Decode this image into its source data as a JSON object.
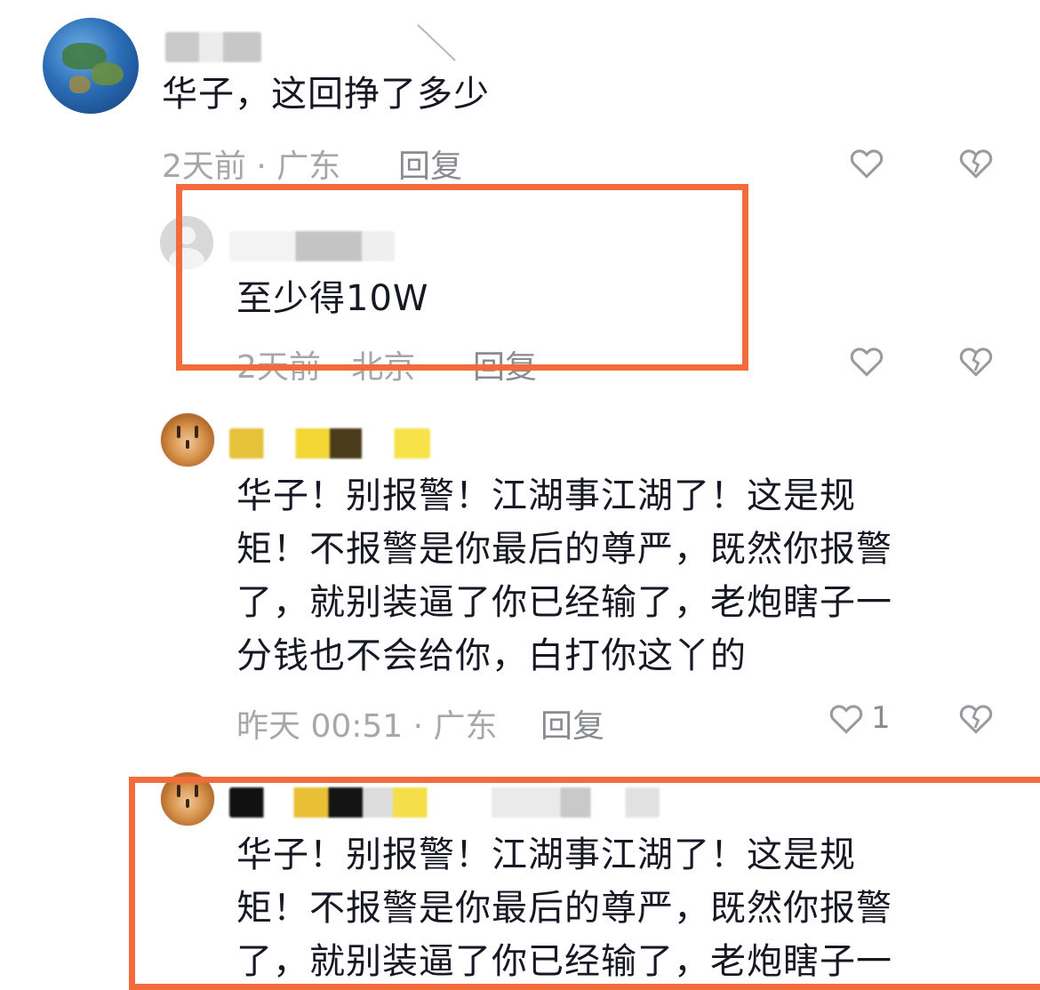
{
  "accent_color": "#f26b3d",
  "comments": [
    {
      "text": "华子，这回挣了多少",
      "meta": "2天前 · 广东",
      "reply_label": "回复",
      "like_icon": "heart-outline-icon",
      "dislike_icon": "broken-heart-icon"
    },
    {
      "text": "至少得10W",
      "meta": "2天前 · 北京",
      "reply_label": "回复",
      "like_icon": "heart-outline-icon",
      "dislike_icon": "broken-heart-icon"
    },
    {
      "lines": [
        "华子！别报警！江湖事江湖了！这是规",
        "矩！不报警是你最后的尊严，既然你报警",
        "了，就别装逼了你已经输了，老炮瞎子一",
        "分钱也不会给你，白打你这丫的"
      ],
      "meta": "昨天 00:51 · 广东",
      "reply_label": "回复",
      "like_count": "1",
      "like_icon": "heart-outline-icon",
      "dislike_icon": "broken-heart-icon"
    },
    {
      "lines": [
        "华子！别报警！江湖事江湖了！这是规",
        "矩！不报警是你最后的尊严，既然你报警",
        "了，就别装逼了你已经输了，老炮瞎子一"
      ]
    }
  ]
}
